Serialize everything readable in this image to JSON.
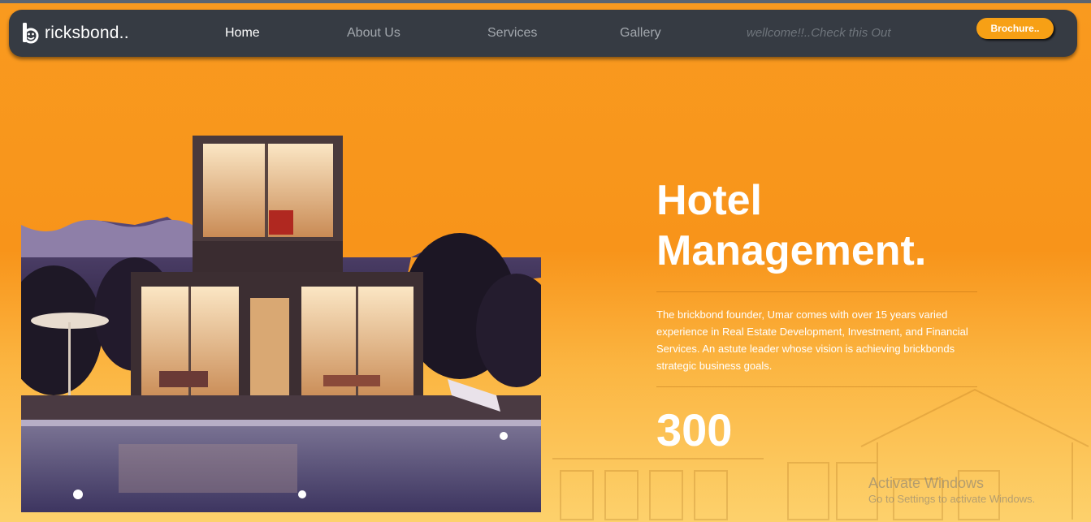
{
  "nav": {
    "brand": "ricksbond..",
    "logo_icon": "brickbond-logo-icon",
    "links": [
      {
        "label": "Home",
        "active": true
      },
      {
        "label": "About Us",
        "active": false
      },
      {
        "label": "Services",
        "active": false
      },
      {
        "label": "Gallery",
        "active": false
      }
    ],
    "promo": "wellcome!!..Check this Out",
    "cta": "Brochure.."
  },
  "hero": {
    "title_line1": "Hotel",
    "title_line2": "Management.",
    "description": "The brickbond founder, Umar comes with over 15 years varied experience in Real Estate Development, Investment, and Financial Services. An astute leader whose vision is achieving brickbonds strategic business goals.",
    "stat": "300",
    "image_subject": "modern-villa-night-pool"
  },
  "watermark": {
    "title": "Activate Windows",
    "subtitle": "Go to Settings to activate Windows."
  },
  "colors": {
    "background": "#f99a1f",
    "navbar": "#363b43",
    "accent": "#f7a015",
    "text_light": "#ffffff",
    "nav_inactive": "#a3a8ae"
  }
}
